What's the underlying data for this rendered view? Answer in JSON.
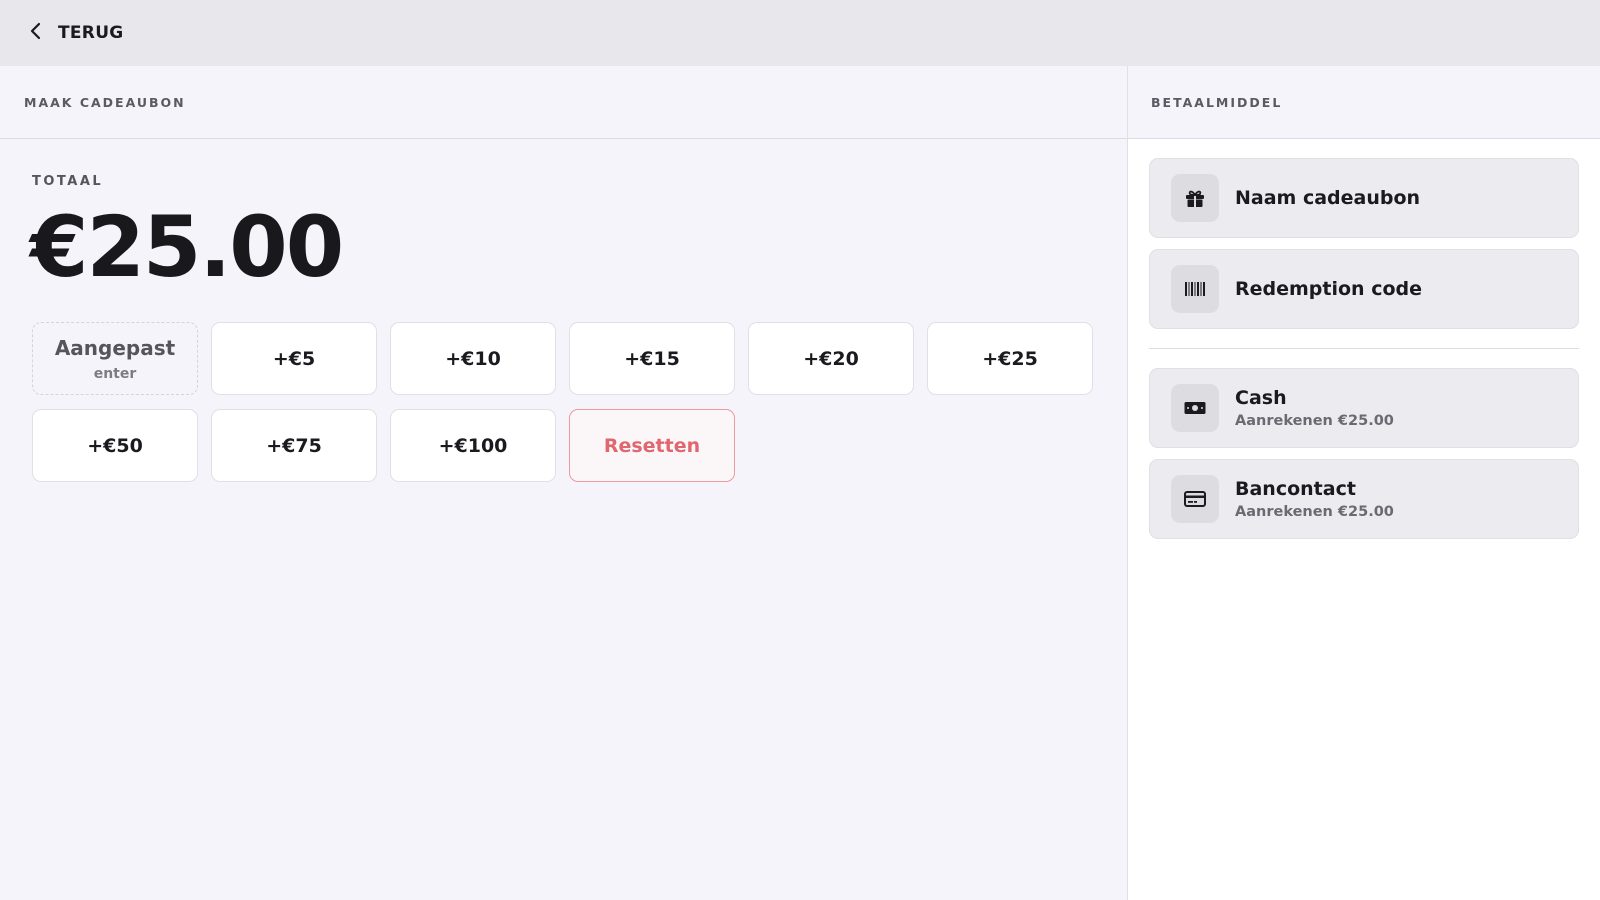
{
  "header": {
    "back_label": "TERUG"
  },
  "main": {
    "section_title": "MAAK CADEAUBON",
    "total_label": "TOTAAL",
    "total_amount": "€25.00",
    "custom": {
      "label": "Aangepast",
      "sub": "enter"
    },
    "amount_buttons": [
      "+€5",
      "+€10",
      "+€15",
      "+€20",
      "+€25",
      "+€50",
      "+€75",
      "+€100"
    ],
    "reset_label": "Resetten"
  },
  "side": {
    "section_title": "BETAALMIDDEL",
    "fields": [
      {
        "label": "Naam cadeaubon",
        "icon": "gift-icon"
      },
      {
        "label": "Redemption code",
        "icon": "barcode-icon"
      }
    ],
    "payment_methods": [
      {
        "label": "Cash",
        "sub": "Aanrekenen €25.00",
        "icon": "cash-icon"
      },
      {
        "label": "Bancontact",
        "sub": "Aanrekenen €25.00",
        "icon": "credit-card-icon"
      }
    ]
  },
  "colors": {
    "accent_reset": "#e0676f",
    "topbar": "#e7e7ec",
    "background": "#f5f4fa"
  }
}
